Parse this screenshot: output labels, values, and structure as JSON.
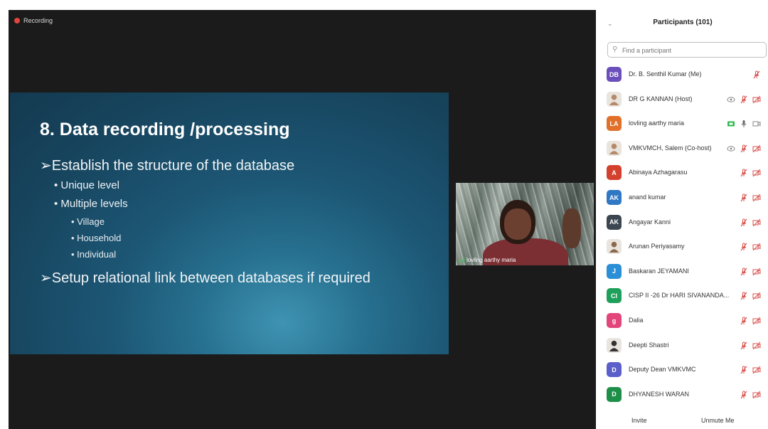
{
  "recording": {
    "label": "Recording"
  },
  "slide": {
    "title": "8. Data recording /processing",
    "bullet1": "➢Establish the structure of the database",
    "sub1": "• Unique level",
    "sub2": "• Multiple levels",
    "subsub": [
      "• Village",
      "• Household",
      "• Individual"
    ],
    "bullet2": "➢Setup relational link between databases if required"
  },
  "video": {
    "name": "lovling aarthy maria"
  },
  "panel": {
    "title": "Participants (101)",
    "search_placeholder": "Find a participant",
    "participants": [
      {
        "initials": "DB",
        "name": "Dr. B. Senthil Kumar (Me)",
        "color": "#6b4fbb",
        "status": "muted-only"
      },
      {
        "initials": "",
        "name": "DR G KANNAN (Host)",
        "color": "#b58a6a",
        "status": "eye-muted-video"
      },
      {
        "initials": "LA",
        "name": "lovling aarthy maria",
        "color": "#e0702a",
        "status": "active"
      },
      {
        "initials": "",
        "name": "VMKVMCH, Salem (Co-host)",
        "color": "#b58a6a",
        "status": "eye-muted-video"
      },
      {
        "initials": "A",
        "name": "Abinaya Azhagarasu",
        "color": "#d3402e",
        "status": "muted-video"
      },
      {
        "initials": "AK",
        "name": "anand kumar",
        "color": "#2f78c4",
        "status": "muted-video"
      },
      {
        "initials": "AK",
        "name": "Angayar Kanni",
        "color": "#3b4651",
        "status": "muted-video"
      },
      {
        "initials": "",
        "name": "Arunan Periyasamy",
        "color": "#8a6a4a",
        "status": "muted-video"
      },
      {
        "initials": "J",
        "name": "Baskaran JEYAMANI",
        "color": "#2a8fd6",
        "status": "muted-video"
      },
      {
        "initials": "CI",
        "name": "CISP II -26 Dr HARI SIVANANDA...",
        "color": "#1fa05a",
        "status": "muted-video"
      },
      {
        "initials": "g",
        "name": "Dalia",
        "color": "#e2457a",
        "status": "muted-video"
      },
      {
        "initials": "",
        "name": "Deepti Shastri",
        "color": "#333333",
        "status": "muted-video"
      },
      {
        "initials": "D",
        "name": "Deputy Dean VMKVMC",
        "color": "#5b5fc9",
        "status": "muted-video"
      },
      {
        "initials": "D",
        "name": "DHYANESH WARAN",
        "color": "#1e8f48",
        "status": "muted-video"
      }
    ],
    "invite_label": "Invite",
    "unmute_label": "Unmute Me"
  },
  "colors": {
    "muted_red": "#d9534f",
    "active_green": "#2eb84c",
    "stage_bg": "#1b1b1b"
  }
}
